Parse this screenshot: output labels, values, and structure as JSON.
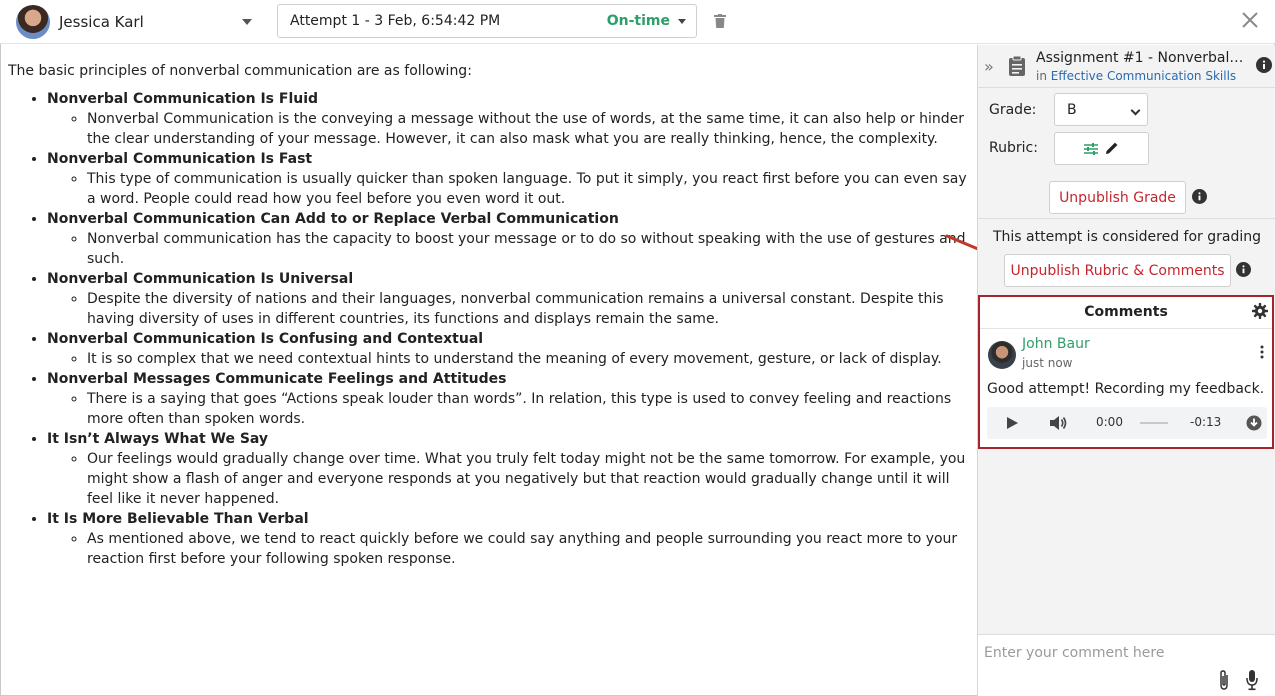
{
  "topbar": {
    "student_name": "Jessica Karl",
    "attempt_label": "Attempt 1 - 3 Feb, 6:54:42 PM",
    "attempt_status": "On-time"
  },
  "content": {
    "intro": "The basic principles of nonverbal communication are as following:",
    "items": [
      {
        "title": "Nonverbal Communication Is Fluid",
        "detail": "Nonverbal Communication is the conveying a message without the use of words, at the same time, it can also help or hinder the clear understanding of your message. However, it can also mask what you are really thinking, hence, the complexity."
      },
      {
        "title": "Nonverbal Communication Is Fast",
        "detail": "This type of communication is usually quicker than spoken language. To put it simply, you react first before you can even say a word. People could read how you feel before you even word it out."
      },
      {
        "title": "Nonverbal Communication Can Add to or Replace Verbal Communication",
        "detail": "Nonverbal communication has the capacity to boost your message or to do so without speaking with the use of gestures and such."
      },
      {
        "title": "Nonverbal Communication Is Universal",
        "detail": "Despite the diversity of nations and their languages, nonverbal communication remains a universal constant. Despite this having diversity of uses in different countries, its functions and displays remain the same."
      },
      {
        "title": "Nonverbal Communication Is Confusing and Contextual",
        "detail": "It is so complex that we need contextual hints to understand the meaning of every movement, gesture, or lack of display."
      },
      {
        "title": "Nonverbal Messages Communicate Feelings and Attitudes",
        "detail": "There is a saying that goes “Actions speak louder than words”. In relation, this type is used to convey feeling and reactions more often than spoken words."
      },
      {
        "title": "It Isn’t Always What We Say",
        "detail": "Our feelings would gradually change over time. What you truly felt today might not be the same tomorrow. For example, you might show a flash of anger and everyone responds at you negatively but that reaction would gradually change until it will feel like it never happened."
      },
      {
        "title": "It Is More Believable Than Verbal",
        "detail": "As mentioned above, we tend to react quickly before we could say anything and people surrounding you react more to your reaction first before your following spoken response."
      }
    ]
  },
  "sidebar": {
    "assignment_title": "Assignment #1 - Nonverbal co...",
    "in_label": "in",
    "course_name": "Effective Communication Skills",
    "grade_label": "Grade:",
    "grade_value": "B",
    "rubric_label": "Rubric:",
    "unpublish_grade": "Unpublish Grade",
    "attempt_note": "This attempt is considered for grading",
    "unpublish_rubric": "Unpublish Rubric & Comments",
    "comments_title": "Comments",
    "comment": {
      "author": "John Baur",
      "time": "just now",
      "text": "Good attempt! Recording my feedback.",
      "audio_start": "0:00",
      "audio_end": "-0:13"
    },
    "comment_placeholder": "Enter your comment here"
  },
  "colors": {
    "accent_green": "#2e9e6a",
    "danger_red": "#c4262e",
    "link_blue": "#2a6bb0",
    "highlight_border": "#a4262c"
  }
}
